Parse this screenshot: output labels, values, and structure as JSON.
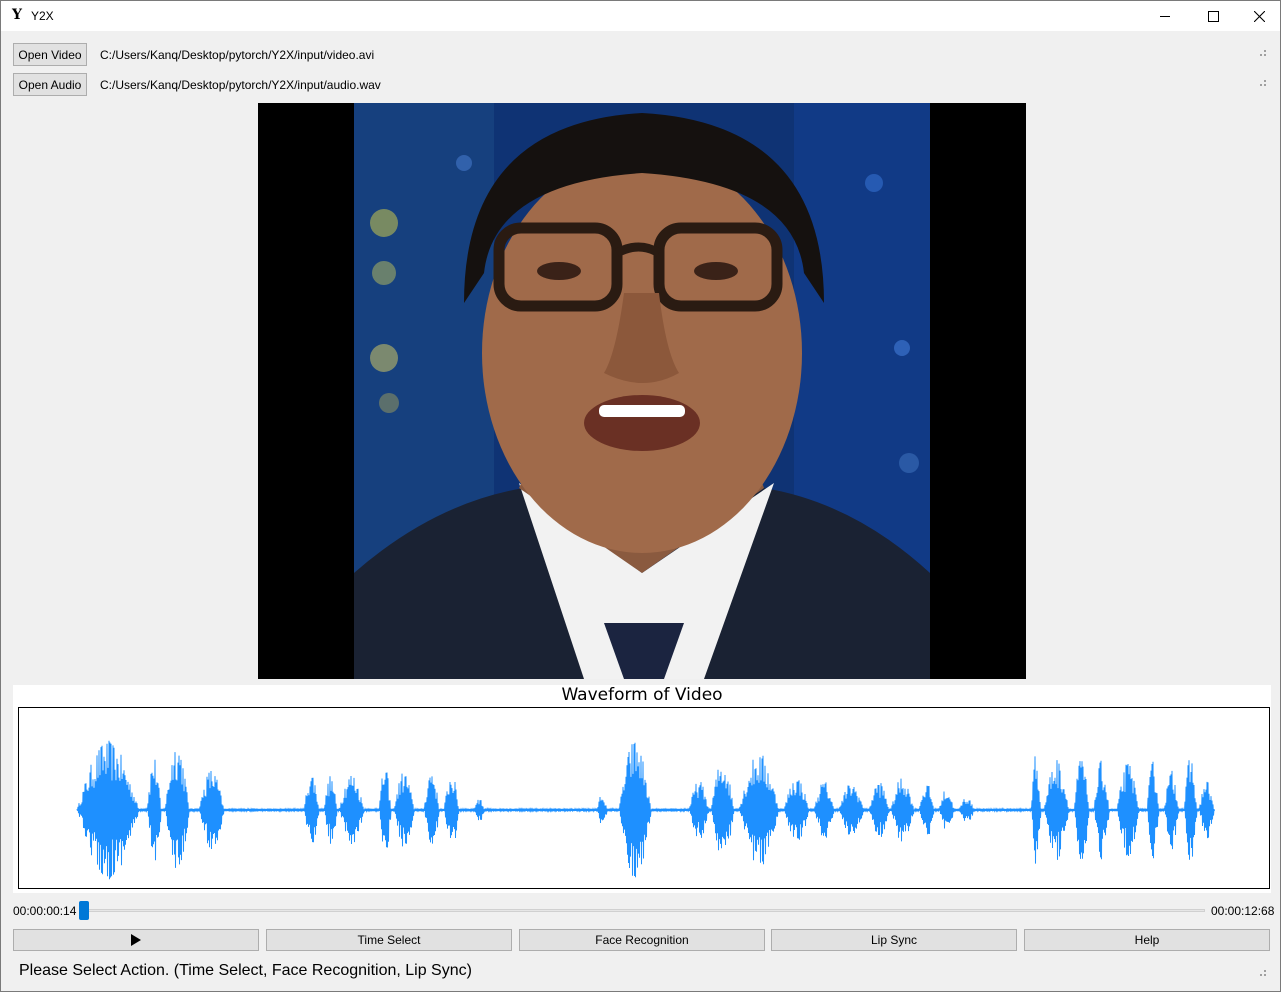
{
  "window": {
    "title": "Y2X",
    "logo": "Y"
  },
  "file_controls": {
    "open_video_label": "Open Video",
    "video_path": "C:/Users/Kanq/Desktop/pytorch/Y2X/input/video.avi",
    "open_audio_label": "Open Audio",
    "audio_path": "C:/Users/Kanq/Desktop/pytorch/Y2X/input/audio.wav"
  },
  "video_player": {
    "frame_description_icon": "news-anchor-video-frame"
  },
  "waveform": {
    "title": "Waveform of Video",
    "color": "#1e90ff"
  },
  "playback": {
    "current_time": "00:00:00:14",
    "total_time": "00:00:12:68",
    "progress": 0.011,
    "accent_color": "#0078d7"
  },
  "actions": {
    "play_icon": "play-icon",
    "time_select_label": "Time Select",
    "face_recognition_label": "Face Recognition",
    "lip_sync_label": "Lip Sync",
    "help_label": "Help"
  },
  "status": {
    "message": "Please Select Action. (Time Select, Face Recognition, Lip Sync)"
  }
}
